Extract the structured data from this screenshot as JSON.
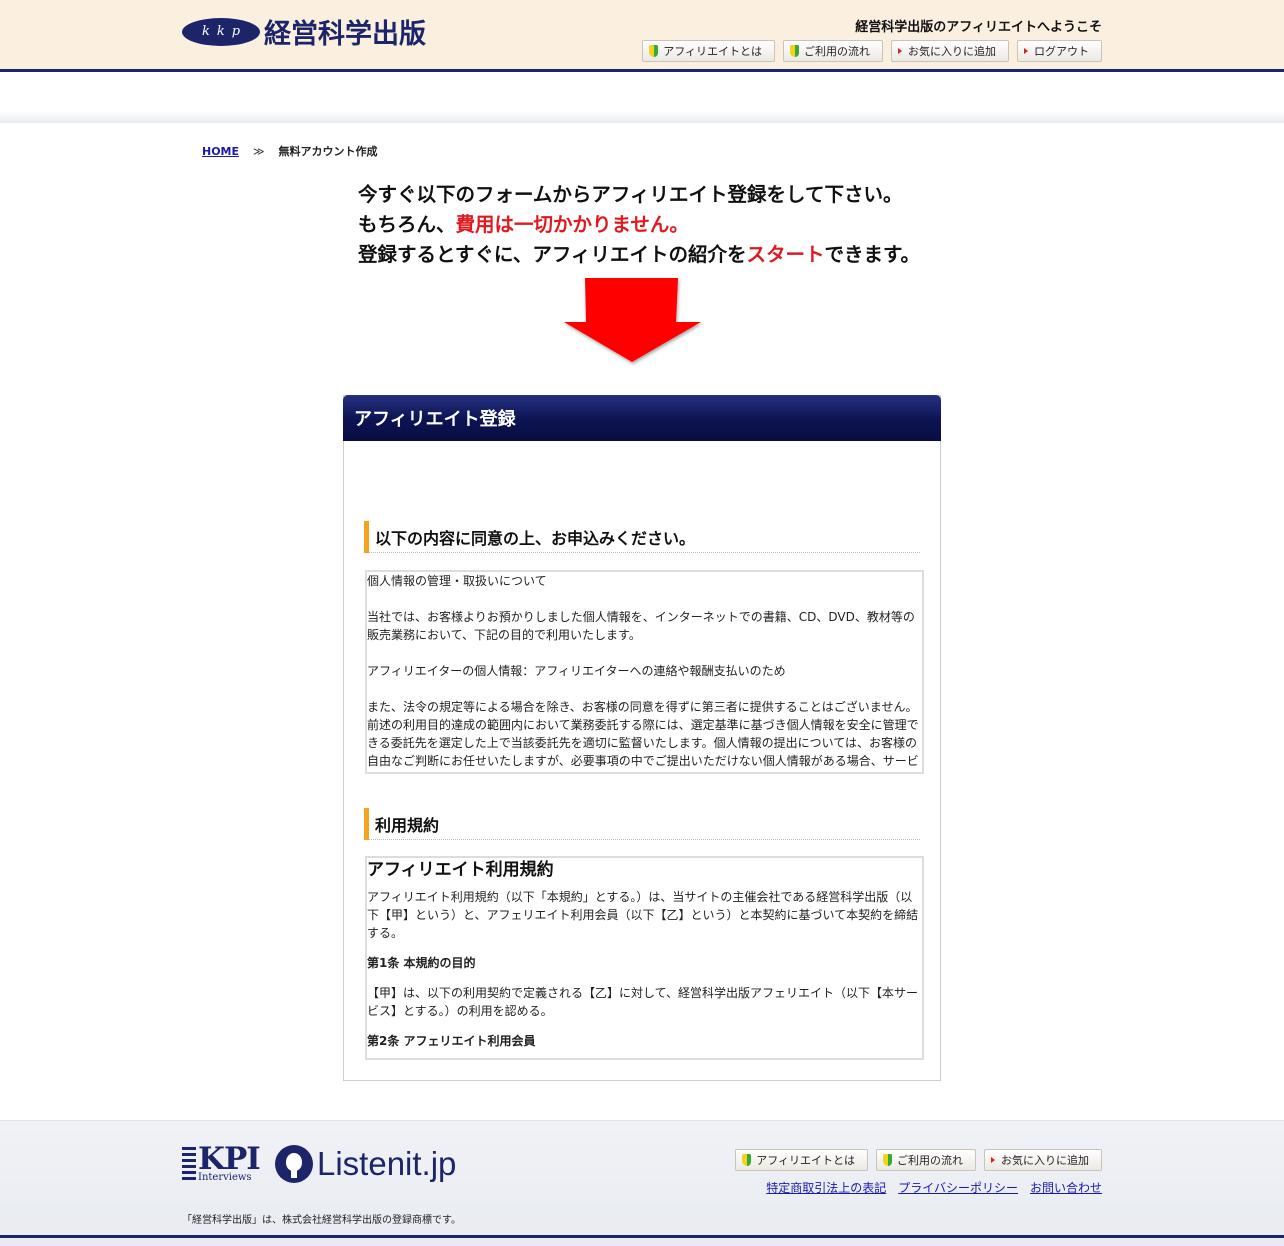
{
  "header": {
    "logo_letters": [
      "k",
      "k",
      "p"
    ],
    "logo_text": "経営科学出版",
    "welcome": "経営科学出版のアフィリエイトへようこそ",
    "nav": [
      {
        "label": "アフィリエイトとは",
        "icon": "beginner-mark-icon"
      },
      {
        "label": "ご利用の流れ",
        "icon": "beginner-mark-icon"
      },
      {
        "label": "お気に入りに追加",
        "icon": "red-triangle-icon"
      },
      {
        "label": "ログアウト",
        "icon": "red-triangle-icon"
      }
    ]
  },
  "breadcrumb": {
    "home": "HOME",
    "separator": "≫",
    "current": "無料アカウント作成"
  },
  "intro": {
    "line1": "今すぐ以下のフォームからアフィリエイト登録をして下さい。",
    "line2_a": "もちろん、",
    "line2_b": "費用は一切かかりません。",
    "line3_a": "登録するとすぐに、アフィリエイトの紹介を",
    "line3_b": "スタート",
    "line3_c": "できます。"
  },
  "panel": {
    "title": "アフィリエイト登録",
    "section1": "以下の内容に同意の上、お申込みください。",
    "privacy": {
      "p1": "個人情報の管理・取扱いについて",
      "p2": "当社では、お客様よりお預かりしました個人情報を、インターネットでの書籍、CD、DVD、教材等の販売業務において、下記の目的で利用いたします。",
      "p3": "アフィリエイターの個人情報：アフィリエイターへの連絡や報酬支払いのため",
      "p4": "また、法令の規定等による場合を除き、お客様の同意を得ずに第三者に提供することはございません。前述の利用目的達成の範囲内において業務委託する際には、選定基準に基づき個人情報を安全に管理できる委託先を選定した上で当該委託先を適切に監督いたします。個人情報の提出については、お客様の自由なご判断にお任せいたしますが、必要事項の中でご提出いただけない個人情報がある場合、サービ"
    },
    "section2": "利用規約",
    "tos": {
      "title": "アフィリエイト利用規約",
      "p1": "アフィリエイト利用規約（以下「本規約」とする。）は、当サイトの主催会社である経営科学出版（以下【甲】という）と、アフェリエイト利用会員（以下【乙】という）と本契約に基づいて本契約を締結する。",
      "art1": "第1条 本規約の目的",
      "p2": "【甲】は、以下の利用契約で定義される【乙】に対して、経営科学出版アフェリエイト（以下【本サービス】とする。）の利用を認める。",
      "art2": "第2条 アフェリエイト利用会員"
    }
  },
  "footer": {
    "kpi_big": "KPI",
    "kpi_small": "Interviews",
    "listenit": "Listenit.jp",
    "nav": [
      {
        "label": "アフィリエイトとは",
        "icon": "beginner-mark-icon"
      },
      {
        "label": "ご利用の流れ",
        "icon": "beginner-mark-icon"
      },
      {
        "label": "お気に入りに追加",
        "icon": "red-triangle-icon"
      }
    ],
    "links": [
      "特定商取引法上の表記",
      "プライバシーポリシー",
      "お問い合わせ"
    ],
    "copyright": "「経営科学出版」は、株式会社経営科学出版の登録商標です。"
  },
  "colors": {
    "navy": "#1c2569",
    "accent_red": "#e0191e",
    "section_bar": "#f5a31a",
    "header_bg": "#fbf0e0"
  }
}
